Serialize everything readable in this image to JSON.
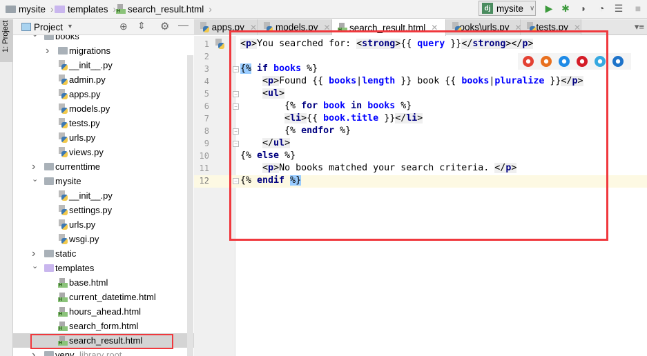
{
  "breadcrumb": [
    {
      "label": "mysite",
      "icon": "folder-icon"
    },
    {
      "label": "templates",
      "icon": "folder-icon"
    },
    {
      "label": "search_result.html",
      "icon": "html-file-icon"
    }
  ],
  "run_config": {
    "label": "mysite"
  },
  "toolbar": [
    "run-icon",
    "debug-icon",
    "coverage-icon",
    "profile-icon",
    "concurrency-icon",
    "stop-icon"
  ],
  "side_strip": {
    "label": "1: Project"
  },
  "project_panel": {
    "title": "Project"
  },
  "tree": [
    {
      "label": "books",
      "level": 1,
      "type": "folder",
      "expanded": true
    },
    {
      "label": "migrations",
      "level": 2,
      "type": "folder",
      "expanded": false
    },
    {
      "label": "__init__.py",
      "level": 2,
      "type": "py"
    },
    {
      "label": "admin.py",
      "level": 2,
      "type": "py"
    },
    {
      "label": "apps.py",
      "level": 2,
      "type": "py"
    },
    {
      "label": "models.py",
      "level": 2,
      "type": "py"
    },
    {
      "label": "tests.py",
      "level": 2,
      "type": "py"
    },
    {
      "label": "urls.py",
      "level": 2,
      "type": "py"
    },
    {
      "label": "views.py",
      "level": 2,
      "type": "py"
    },
    {
      "label": "currenttime",
      "level": 1,
      "type": "folder",
      "expanded": false
    },
    {
      "label": "mysite",
      "level": 1,
      "type": "folder",
      "expanded": true
    },
    {
      "label": "__init__.py",
      "level": 2,
      "type": "py"
    },
    {
      "label": "settings.py",
      "level": 2,
      "type": "py"
    },
    {
      "label": "urls.py",
      "level": 2,
      "type": "py"
    },
    {
      "label": "wsgi.py",
      "level": 2,
      "type": "py"
    },
    {
      "label": "static",
      "level": 1,
      "type": "folder",
      "expanded": false
    },
    {
      "label": "templates",
      "level": 1,
      "type": "tfolder",
      "expanded": true
    },
    {
      "label": "base.html",
      "level": 2,
      "type": "html"
    },
    {
      "label": "current_datetime.html",
      "level": 2,
      "type": "html"
    },
    {
      "label": "hours_ahead.html",
      "level": 2,
      "type": "html"
    },
    {
      "label": "search_form.html",
      "level": 2,
      "type": "html"
    },
    {
      "label": "search_result.html",
      "level": 2,
      "type": "html",
      "selected": true
    },
    {
      "label": "venv",
      "level": 1,
      "type": "folder",
      "expanded": false,
      "suffix": "library root"
    }
  ],
  "tabs": [
    {
      "label": "apps.py",
      "type": "py"
    },
    {
      "label": "models.py",
      "type": "py"
    },
    {
      "label": "search_result.html",
      "type": "html",
      "active": true
    },
    {
      "label": "books\\urls.py",
      "type": "py"
    },
    {
      "label": "tests.py",
      "type": "py"
    }
  ],
  "code": [
    [
      [
        "<",
        "tag"
      ],
      [
        "p",
        "tag tn"
      ],
      [
        ">",
        "tag"
      ],
      [
        "You searched for: ",
        ""
      ],
      [
        "<",
        "tag"
      ],
      [
        "strong",
        "tag tn"
      ],
      [
        ">",
        "tag"
      ],
      [
        "{{ ",
        ""
      ],
      [
        "query",
        "var"
      ],
      [
        " }}",
        ""
      ],
      [
        "</",
        "tag"
      ],
      [
        "strong",
        "tag tn"
      ],
      [
        ">",
        "tag"
      ],
      [
        "</",
        "tag"
      ],
      [
        "p",
        "tag tn"
      ],
      [
        ">",
        "tag"
      ]
    ],
    [],
    [
      [
        "{%",
        "hl"
      ],
      [
        " ",
        ""
      ],
      [
        "if",
        "kw"
      ],
      [
        " ",
        ""
      ],
      [
        "books",
        "var"
      ],
      [
        " %}",
        ""
      ]
    ],
    [
      [
        "    ",
        ""
      ],
      [
        "<",
        "tag"
      ],
      [
        "p",
        "tag tn"
      ],
      [
        ">",
        "tag"
      ],
      [
        "Found {{ ",
        ""
      ],
      [
        "books",
        "var"
      ],
      [
        "|",
        ""
      ],
      [
        "length",
        "var"
      ],
      [
        " }} book {{ ",
        ""
      ],
      [
        "books",
        "var"
      ],
      [
        "|",
        ""
      ],
      [
        "pluralize",
        "var"
      ],
      [
        " }}",
        ""
      ],
      [
        "</",
        "tag"
      ],
      [
        "p",
        "tag tn"
      ],
      [
        ">",
        "tag"
      ]
    ],
    [
      [
        "    ",
        ""
      ],
      [
        "<",
        "tag"
      ],
      [
        "ul",
        "tag tn"
      ],
      [
        ">",
        "tag"
      ]
    ],
    [
      [
        "        {% ",
        ""
      ],
      [
        "for",
        "kw"
      ],
      [
        " ",
        ""
      ],
      [
        "book",
        "var"
      ],
      [
        " ",
        ""
      ],
      [
        "in",
        "kw"
      ],
      [
        " ",
        ""
      ],
      [
        "books",
        "var"
      ],
      [
        " %}",
        ""
      ]
    ],
    [
      [
        "        ",
        ""
      ],
      [
        "<",
        "tag"
      ],
      [
        "li",
        "tag tn"
      ],
      [
        ">",
        "tag"
      ],
      [
        "{{ ",
        ""
      ],
      [
        "book.title",
        "var"
      ],
      [
        " }}",
        ""
      ],
      [
        "</",
        "tag"
      ],
      [
        "li",
        "tag tn"
      ],
      [
        ">",
        "tag"
      ]
    ],
    [
      [
        "        {% ",
        ""
      ],
      [
        "endfor",
        "kw"
      ],
      [
        " %}",
        ""
      ]
    ],
    [
      [
        "    ",
        ""
      ],
      [
        "</",
        "tag"
      ],
      [
        "ul",
        "tag tn"
      ],
      [
        ">",
        "tag"
      ]
    ],
    [
      [
        "{% ",
        ""
      ],
      [
        "else",
        "kw"
      ],
      [
        " %}",
        ""
      ]
    ],
    [
      [
        "    ",
        ""
      ],
      [
        "<",
        "tag"
      ],
      [
        "p",
        "tag tn"
      ],
      [
        ">",
        "tag"
      ],
      [
        "No books matched your search criteria. ",
        ""
      ],
      [
        "</",
        "tag"
      ],
      [
        "p",
        "tag tn"
      ],
      [
        ">",
        "tag"
      ]
    ],
    [
      [
        "{% ",
        ""
      ],
      [
        "endif",
        "kw"
      ],
      [
        " ",
        ""
      ],
      [
        "%}",
        "hl"
      ]
    ]
  ],
  "browsers": [
    {
      "icon": "chrome-icon",
      "color": "#e34133"
    },
    {
      "icon": "firefox-icon",
      "color": "#e8701f"
    },
    {
      "icon": "safari-icon",
      "color": "#1e8ae6"
    },
    {
      "icon": "opera-icon",
      "color": "#d41c27"
    },
    {
      "icon": "ie-icon",
      "color": "#36a8e0"
    },
    {
      "icon": "edge-icon",
      "color": "#1e73c9"
    }
  ],
  "colors": {
    "annotation": "#f0383d",
    "keyword": "#000080",
    "variable": "#0000ff",
    "selection": "#99ccff"
  }
}
